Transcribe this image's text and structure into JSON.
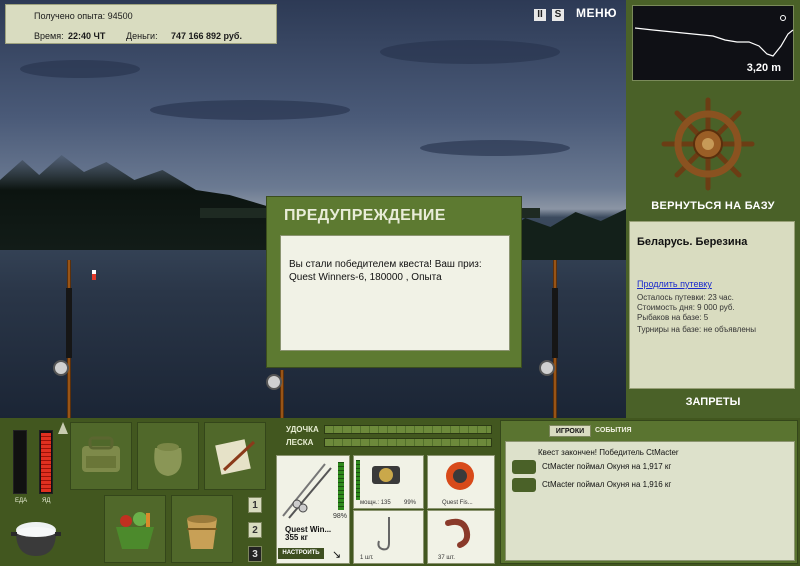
{
  "info": {
    "xp_label": "Получено опыта:",
    "xp_value": "94500",
    "time_label": "Время:",
    "time_value": "22:40 ЧТ",
    "money_label": "Деньги:",
    "money_value": "747 166 892 руб."
  },
  "controls": {
    "pause_icon": "pause-icon",
    "pause_glyph": "II",
    "sound_icon": "sound-icon",
    "sound_glyph": "S",
    "menu_label": "МЕНЮ"
  },
  "depth": {
    "value": "3,20 m"
  },
  "base": {
    "return_label": "ВЕРНУТЬСЯ НА БАЗУ",
    "place": "Беларусь. Березина",
    "extend_link": "Продлить путевку",
    "lines": [
      "Осталось путевки: 23 час.",
      "Стоимость дня: 9 000 руб.",
      "Рыбаков на базе: 5",
      "Турниры на базе: не объявлены"
    ],
    "bans_label": "ЗАПРЕТЫ"
  },
  "dialog": {
    "title": "ПРЕДУПРЕЖДЕНИЕ",
    "message": "Вы стали победителем квеста! Ваш приз: Quest Winners-6, 180000 , Опыта"
  },
  "status": {
    "food_label": "ЕДА",
    "poison_label": "ЯД",
    "food_level": 0.0,
    "poison_level": 0.95
  },
  "inventory": {
    "numbers": [
      "1",
      "2",
      "3"
    ],
    "selected": "3"
  },
  "tackle": {
    "rod_label": "УДОЧКА",
    "line_label": "ЛЕСКА",
    "rod_bar": 0.0,
    "line_bar": 0.0,
    "rod_name": "Quest Win...",
    "rod_weight": "355 кг",
    "rod_condition": "98%",
    "configure_label": "НАСТРОИТЬ",
    "reel_info": "мощн.: 135",
    "reel_condition": "99%",
    "line_name": "Quest Fis...",
    "hook_count": "1 шт.",
    "bait_count": "37 шт."
  },
  "chat": {
    "tab_players": "ИГРОКИ",
    "tab_events": "СОБЫТИЯ",
    "messages": [
      "Квест закончен! Победитель CtMacter",
      "CtMacter поймал Окуня на 1,917 кг",
      "CtMacter поймал Окуня на 1,916 кг"
    ]
  },
  "colors": {
    "panel_green": "#4a6128",
    "panel_light": "#d9dcc0",
    "accent_red": "#e03020"
  }
}
